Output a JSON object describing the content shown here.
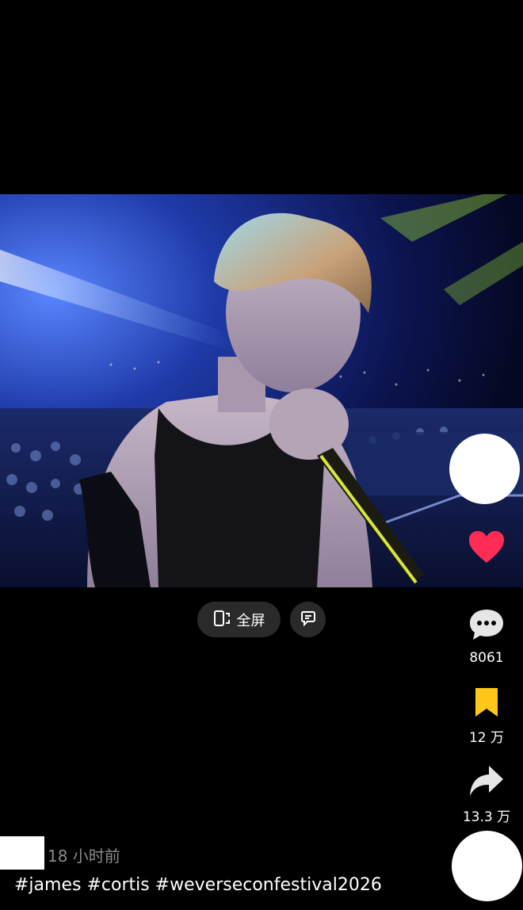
{
  "video": {
    "fullscreen_label": "全屏"
  },
  "actions": {
    "comment_count": "8061",
    "collect_count": "12 万",
    "share_count": "13.3 万"
  },
  "post": {
    "time_ago": "18 小时前",
    "caption": "#james #cortis #weverseconfestival2026"
  },
  "colors": {
    "like": "#ff2d55",
    "collect": "#ffc71a",
    "background": "#000000"
  },
  "icons": {
    "like": "heart-icon",
    "comment": "comment-bubble-icon",
    "collect": "bookmark-icon",
    "share": "share-arrow-icon",
    "fullscreen": "fullscreen-icon",
    "share_video": "share-video-icon"
  }
}
